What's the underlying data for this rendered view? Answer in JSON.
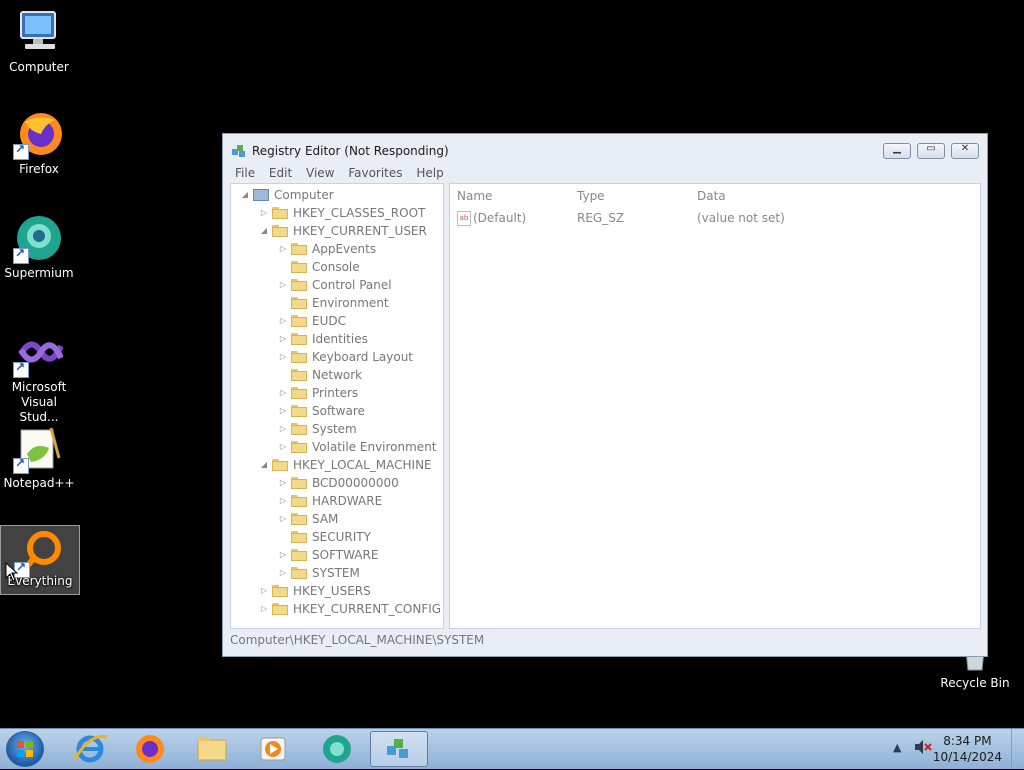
{
  "desktop": {
    "icons": [
      {
        "label": "Computer"
      },
      {
        "label": "Firefox"
      },
      {
        "label": "Supermium"
      },
      {
        "label": "Microsoft Visual Stud..."
      },
      {
        "label": "Notepad++"
      },
      {
        "label": "Everything"
      },
      {
        "label": "Recycle Bin"
      }
    ]
  },
  "window": {
    "title": "Registry Editor (Not Responding)",
    "menu": [
      "File",
      "Edit",
      "View",
      "Favorites",
      "Help"
    ],
    "tree": [
      "Computer",
      "HKEY_CLASSES_ROOT",
      "HKEY_CURRENT_USER",
      "AppEvents",
      "Console",
      "Control Panel",
      "Environment",
      "EUDC",
      "Identities",
      "Keyboard Layout",
      "Network",
      "Printers",
      "Software",
      "System",
      "Volatile Environment",
      "HKEY_LOCAL_MACHINE",
      "BCD00000000",
      "HARDWARE",
      "SAM",
      "SECURITY",
      "SOFTWARE",
      "SYSTEM",
      "HKEY_USERS",
      "HKEY_CURRENT_CONFIG"
    ],
    "columns": {
      "name": "Name",
      "type": "Type",
      "data": "Data"
    },
    "values": [
      {
        "name": "(Default)",
        "type": "REG_SZ",
        "data": "(value not set)"
      }
    ],
    "status_path": "Computer\\HKEY_LOCAL_MACHINE\\SYSTEM"
  },
  "taskbar": {
    "time": "8:34 PM",
    "date": "10/14/2024"
  }
}
